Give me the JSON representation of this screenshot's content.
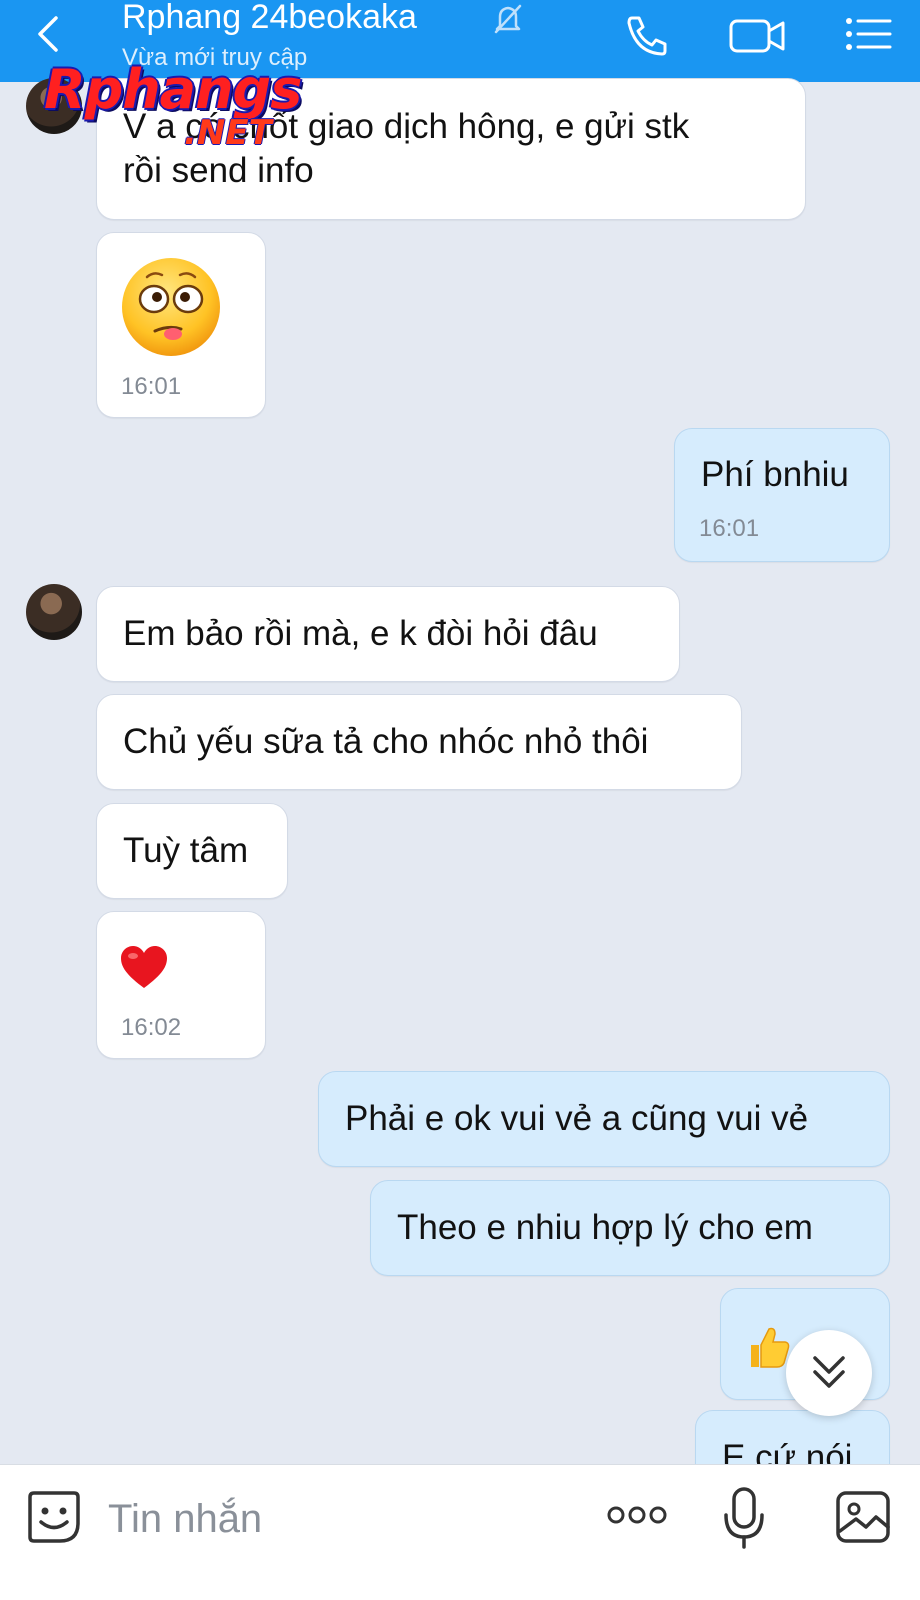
{
  "header": {
    "title": "Rphang 24beokaka",
    "status": "Vừa mới truy cập"
  },
  "watermark": {
    "main": "Rphangs",
    "suffix": ".NET"
  },
  "messages": [
    {
      "sender": "them",
      "text_line1": "V a có chốt giao dịch hông, e gửi stk",
      "text_line2": "rồi send info"
    },
    {
      "sender": "them",
      "emoji": "😋",
      "time": "16:01"
    },
    {
      "sender": "me",
      "text": "Phí bnhiu",
      "time": "16:01"
    },
    {
      "sender": "them",
      "text": "Em bảo rồi mà, e k đòi hỏi đâu"
    },
    {
      "sender": "them",
      "text": "Chủ yếu sữa tả cho nhóc nhỏ thôi"
    },
    {
      "sender": "them",
      "text": "Tuỳ tâm"
    },
    {
      "sender": "them",
      "emoji": "❤️",
      "time": "16:02"
    },
    {
      "sender": "me",
      "text": "Phải e ok vui vẻ a cũng vui vẻ"
    },
    {
      "sender": "me",
      "text": "Theo e nhiu hợp lý cho em"
    },
    {
      "sender": "me",
      "emoji": "👍"
    },
    {
      "sender": "me",
      "text": "E cứ nói"
    }
  ],
  "composer": {
    "placeholder": "Tin nhắn"
  },
  "icons": {
    "back": "chevron-left-icon",
    "mute": "bell-off-icon",
    "call": "phone-icon",
    "video": "video-camera-icon",
    "menu": "list-menu-icon",
    "scroll": "double-chevron-down-icon",
    "sticker": "sticker-smiley-icon",
    "more": "more-dots-icon",
    "mic": "microphone-icon",
    "image": "image-icon"
  },
  "colors": {
    "header": "#1a96f2",
    "my_bubble": "#d6ecfd",
    "their_bubble": "#ffffff",
    "background": "#e4e9f2"
  }
}
